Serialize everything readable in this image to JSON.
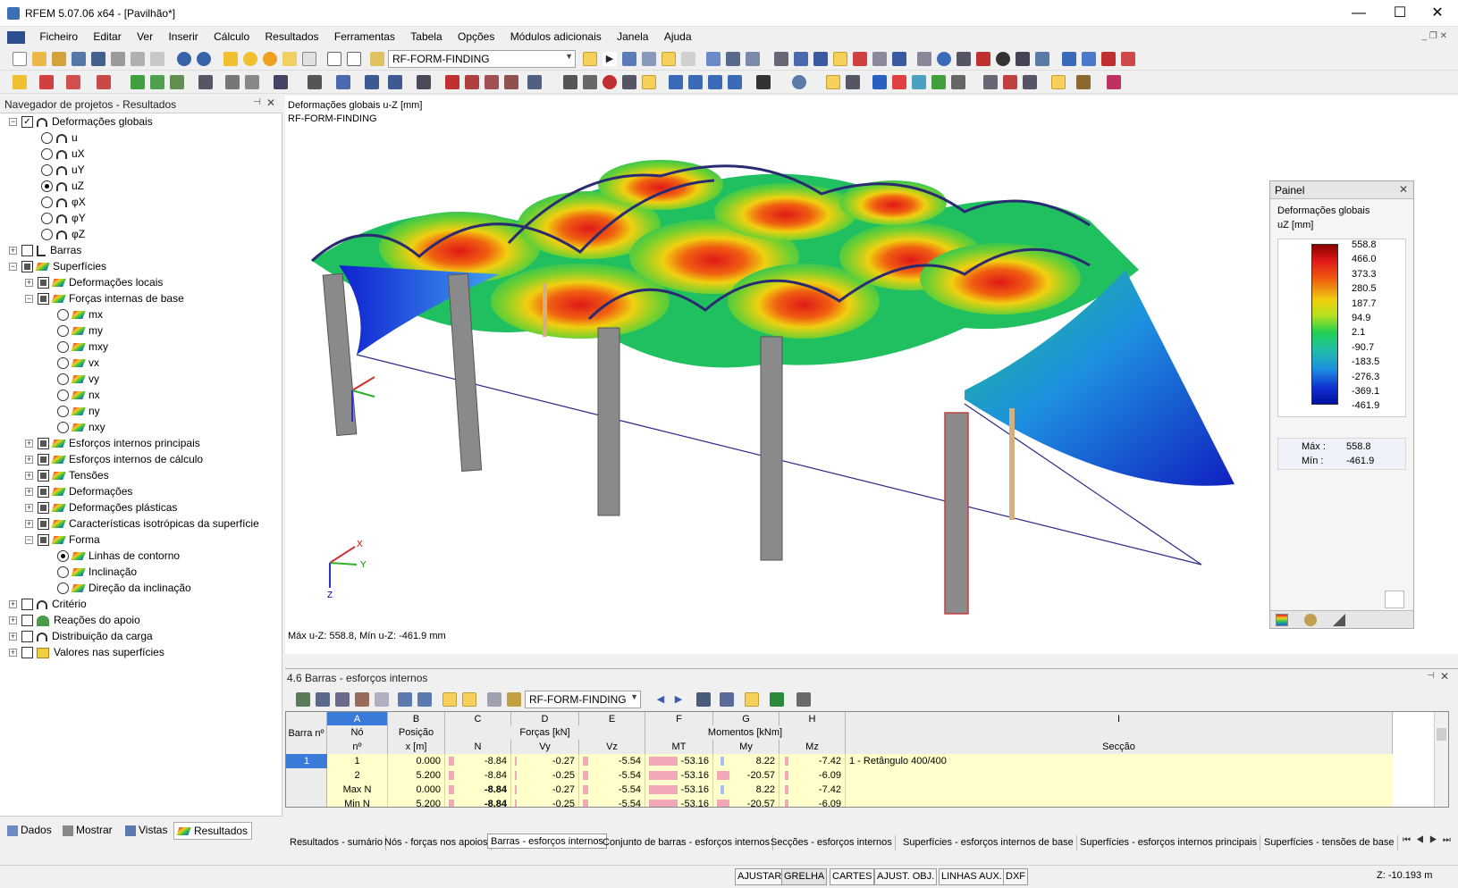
{
  "window": {
    "title": "RFEM 5.07.06 x64 - [Pavilhão*]"
  },
  "menu": [
    "Ficheiro",
    "Editar",
    "Ver",
    "Inserir",
    "Cálculo",
    "Resultados",
    "Ferramentas",
    "Tabela",
    "Opções",
    "Módulos adicionais",
    "Janela",
    "Ajuda"
  ],
  "toolbar": {
    "load_case": "RF-FORM-FINDING"
  },
  "navigator": {
    "title": "Navegador de projetos - Resultados",
    "items": [
      {
        "label": "Deformações globais"
      },
      {
        "label": "u"
      },
      {
        "label": "uX"
      },
      {
        "label": "uY"
      },
      {
        "label": "uZ"
      },
      {
        "label": "φX"
      },
      {
        "label": "φY"
      },
      {
        "label": "φZ"
      },
      {
        "label": "Barras"
      },
      {
        "label": "Superfícies"
      },
      {
        "label": "Deformações locais"
      },
      {
        "label": "Forças internas de base"
      },
      {
        "label": "mx"
      },
      {
        "label": "my"
      },
      {
        "label": "mxy"
      },
      {
        "label": "vx"
      },
      {
        "label": "vy"
      },
      {
        "label": "nx"
      },
      {
        "label": "ny"
      },
      {
        "label": "nxy"
      },
      {
        "label": "Esforços internos principais"
      },
      {
        "label": "Esforços internos de cálculo"
      },
      {
        "label": "Tensões"
      },
      {
        "label": "Deformações"
      },
      {
        "label": "Deformações plásticas"
      },
      {
        "label": "Características isotrópicas da superfície"
      },
      {
        "label": "Forma"
      },
      {
        "label": "Linhas de contorno"
      },
      {
        "label": "Inclinação"
      },
      {
        "label": "Direção da inclinação"
      },
      {
        "label": "Critério"
      },
      {
        "label": "Reações do apoio"
      },
      {
        "label": "Distribuição da carga"
      },
      {
        "label": "Valores nas superfícies"
      }
    ],
    "tabs": [
      "Dados",
      "Mostrar",
      "Vistas",
      "Resultados"
    ]
  },
  "viewport": {
    "title1": "Deformações globais u-Z [mm]",
    "title2": "RF-FORM-FINDING",
    "maxmin": "Máx u-Z: 558.8, Mín u-Z: -461.9 mm",
    "axes": {
      "x": "X",
      "y": "Y",
      "z": "Z"
    }
  },
  "panel": {
    "title": "Painel",
    "heading": "Deformações globais",
    "unit": "uZ [mm]",
    "legend": [
      "558.8",
      "466.0",
      "373.3",
      "280.5",
      "187.7",
      "94.9",
      "2.1",
      "-90.7",
      "-183.5",
      "-276.3",
      "-369.1",
      "-461.9"
    ],
    "max_label": "Máx  :",
    "max_value": "558.8",
    "min_label": "Mín  :",
    "min_value": "-461.9"
  },
  "table": {
    "title": "4.6 Barras - esforços internos",
    "combo": "RF-FORM-FINDING",
    "col_letters": [
      "A",
      "B",
      "C",
      "D",
      "E",
      "F",
      "G",
      "H",
      "I"
    ],
    "headers": {
      "bar": "Barra nº",
      "node": "Nó",
      "node_n": "nº",
      "pos": "Posição",
      "pos_unit": "x [m]",
      "forces": "Forças [kN]",
      "N": "N",
      "Vy": "Vy",
      "Vz": "Vz",
      "moments": "Momentos [kNm]",
      "MT": "MT",
      "My": "My",
      "Mz": "Mz",
      "section": "Secção"
    },
    "rows": [
      {
        "bar": "1",
        "node": "1",
        "x": "0.000",
        "N": "-8.84",
        "Vy": "-0.27",
        "Vz": "-5.54",
        "MT": "-53.16",
        "My": "8.22",
        "Mz": "-7.42",
        "sec": "1 - Retângulo 400/400"
      },
      {
        "bar": "",
        "node": "2",
        "x": "5.200",
        "N": "-8.84",
        "Vy": "-0.25",
        "Vz": "-5.54",
        "MT": "-53.16",
        "My": "-20.57",
        "Mz": "-6.09",
        "sec": ""
      },
      {
        "bar": "",
        "node": "Max N",
        "x": "0.000",
        "N": "-8.84",
        "Vy": "-0.27",
        "Vz": "-5.54",
        "MT": "-53.16",
        "My": "8.22",
        "Mz": "-7.42",
        "sec": ""
      },
      {
        "bar": "",
        "node": "Min N",
        "x": "5.200",
        "N": "-8.84",
        "Vy": "-0.25",
        "Vz": "-5.54",
        "MT": "-53.16",
        "My": "-20.57",
        "Mz": "-6.09",
        "sec": ""
      }
    ],
    "tabs": [
      "Resultados - sumário",
      "Nós - forças nos apoios",
      "Barras - esforços internos",
      "Conjunto de barras - esforços internos",
      "Secções - esforços internos",
      "Superfícies - esforços internos de base",
      "Superfícies - esforços internos principais",
      "Superfícies - tensões de base"
    ]
  },
  "status": {
    "buttons": [
      "AJUSTAR",
      "GRELHA",
      "CARTES",
      "AJUST. OBJ.",
      "LINHAS AUX.",
      "DXF"
    ],
    "coord": "Z:  -10.193 m"
  }
}
